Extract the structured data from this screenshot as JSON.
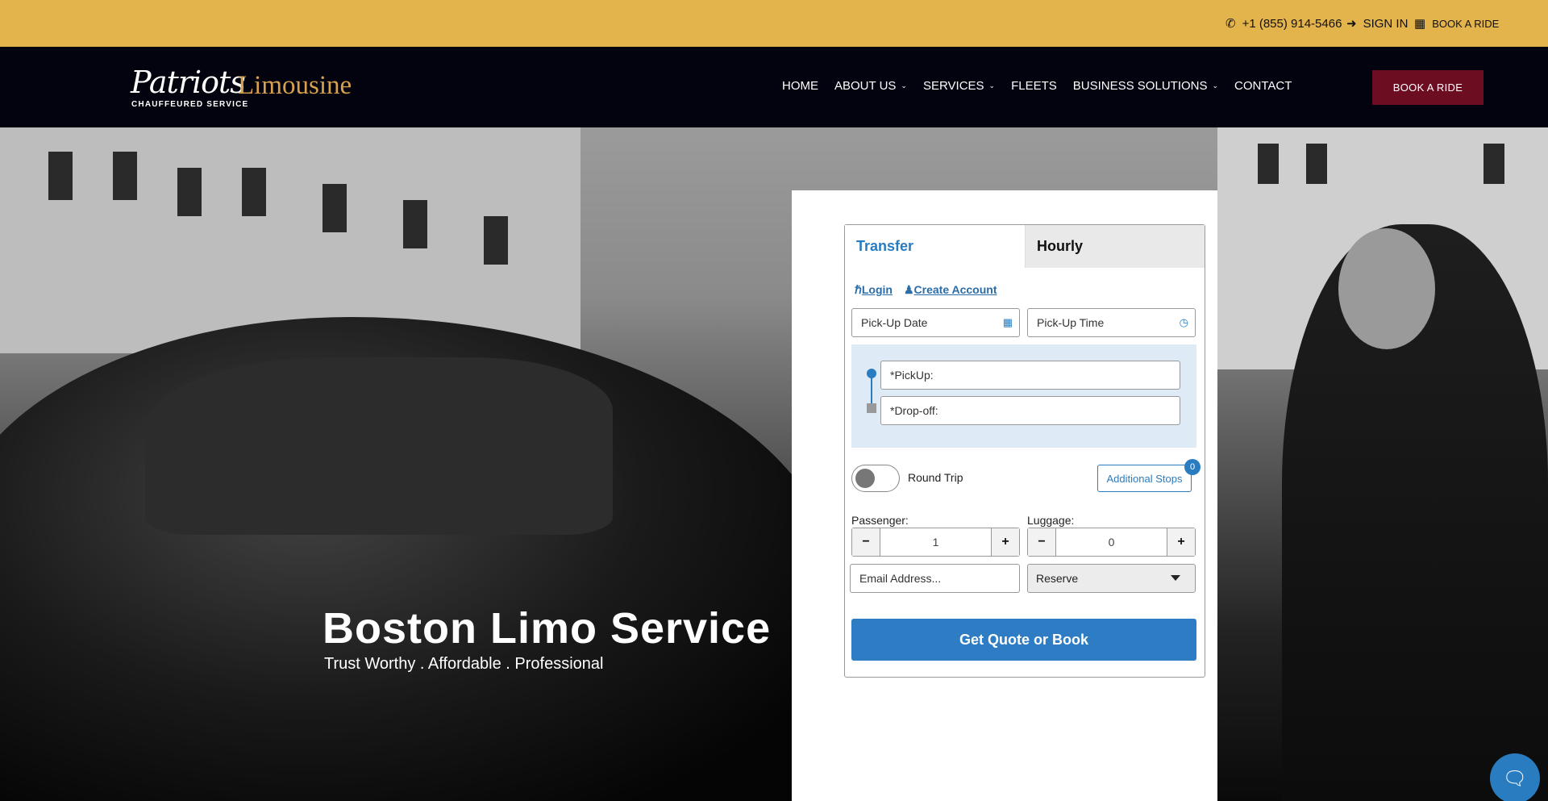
{
  "topbar": {
    "phone": "+1 (855) 914-5466",
    "sign_in": "SIGN IN",
    "book": "BOOK A RIDE"
  },
  "logo": {
    "script": "Patriots",
    "limo": "Limousine",
    "sub": "CHAUFFEURED SERVICE"
  },
  "nav": {
    "items": [
      {
        "label": "HOME"
      },
      {
        "label": "ABOUT US"
      },
      {
        "label": "SERVICES"
      },
      {
        "label": "FLEETS"
      },
      {
        "label": "BUSINESS SOLUTIONS"
      },
      {
        "label": "CONTACT"
      }
    ],
    "cta": "BOOK A RIDE"
  },
  "hero": {
    "title": "Boston Limo Service",
    "subtitle": "Trust Worthy . Affordable . Professional"
  },
  "booking": {
    "tabs": [
      {
        "label": "Transfer"
      },
      {
        "label": "Hourly"
      }
    ],
    "login": "Login",
    "create_account": "Create Account",
    "pickup_date_placeholder": "Pick-Up Date",
    "pickup_time_placeholder": "Pick-Up Time",
    "pickup_placeholder": "*PickUp:",
    "dropoff_placeholder": "*Drop-off:",
    "round_trip": "Round Trip",
    "additional_stops": "Additional Stops",
    "stops_count": "0",
    "passenger_label": "Passenger:",
    "passenger_value": "1",
    "luggage_label": "Luggage:",
    "luggage_value": "0",
    "email_placeholder": "Email Address...",
    "reserve_value": "Reserve",
    "submit": "Get Quote or Book"
  },
  "colors": {
    "topbar": "#e3b34c",
    "navbar": "#03030f",
    "cta": "#6d0d22",
    "accent": "#2a7cc0"
  }
}
